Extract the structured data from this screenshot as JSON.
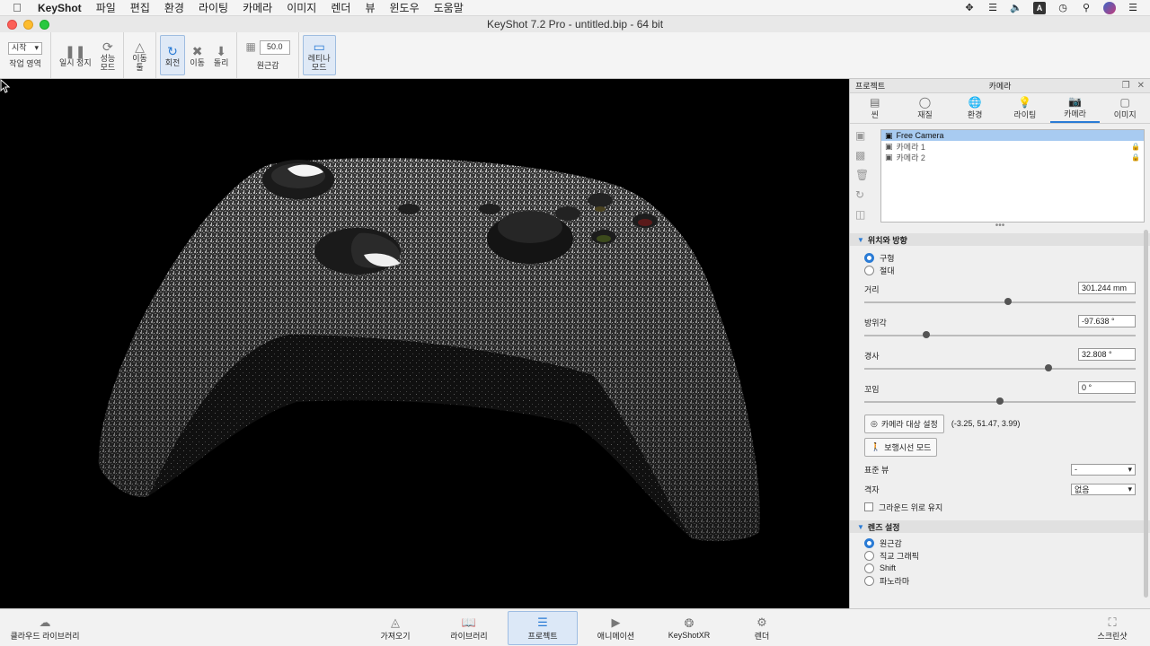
{
  "menubar": {
    "app_name": "KeyShot",
    "items": [
      "파일",
      "편집",
      "환경",
      "라이팅",
      "카메라",
      "이미지",
      "렌더",
      "뷰",
      "윈도우",
      "도움말"
    ],
    "status_ime": "A"
  },
  "window": {
    "title": "KeyShot 7.2 Pro  - untitled.bip  - 64 bit"
  },
  "toolbar": {
    "workspace_select": "시작",
    "workspace_label": "작업 영역",
    "pause_label": "일시 정지",
    "perf_label_1": "성능",
    "perf_label_2": "모드",
    "move_obj_label_1": "이동",
    "move_obj_label_2": "툴",
    "rotate_label": "회전",
    "pan_label": "이동",
    "dolly_label": "돌리",
    "fov_value": "50.0",
    "fov_label": "원근감",
    "retina_label_1": "레티나",
    "retina_label_2": "모드"
  },
  "panel": {
    "left_title": "프로젝트",
    "title": "카메라",
    "tabs": [
      "씬",
      "재질",
      "환경",
      "라이팅",
      "카메라",
      "이미지"
    ],
    "active_tab": "카메라",
    "cameras": [
      {
        "name": "Free Camera",
        "selected": true,
        "locked": false
      },
      {
        "name": "카메라 1",
        "selected": false,
        "locked": true
      },
      {
        "name": "카메라 2",
        "selected": false,
        "locked": true
      }
    ],
    "position_section": "위치와 방향",
    "mode_options": [
      "구형",
      "절대"
    ],
    "mode_selected": "구형",
    "distance_label": "거리",
    "distance_value": "301.244 mm",
    "distance_fraction": 0.53,
    "azimuth_label": "방위각",
    "azimuth_value": "-97.638 °",
    "azimuth_fraction": 0.23,
    "inclination_label": "경사",
    "inclination_value": "32.808 °",
    "inclination_fraction": 0.68,
    "twist_label": "꼬임",
    "twist_value": "0 °",
    "twist_fraction": 0.5,
    "set_target_label": "카메라 대상 설정",
    "target_coords": "(-3.25, 51.47, 3.99)",
    "walk_mode_label": "보행시선 모드",
    "standard_view_label": "표준 뷰",
    "standard_view_value": "-",
    "grid_label": "격자",
    "grid_value": "없음",
    "keep_above_ground_label": "그라운드 위로 유지",
    "lens_section": "렌즈 설정",
    "lens_options": [
      "원근감",
      "직교 그래픽",
      "Shift",
      "파노라마"
    ],
    "lens_selected": "원근감"
  },
  "bottombar": {
    "cloud_library": "클라우드 라이브러리",
    "import": "가져오기",
    "library": "라이브러리",
    "project": "프로젝트",
    "animation": "애니메이션",
    "keyshotxr": "KeyShotXR",
    "render": "렌더",
    "screenshot": "스크린샷",
    "active": "프로젝트"
  }
}
